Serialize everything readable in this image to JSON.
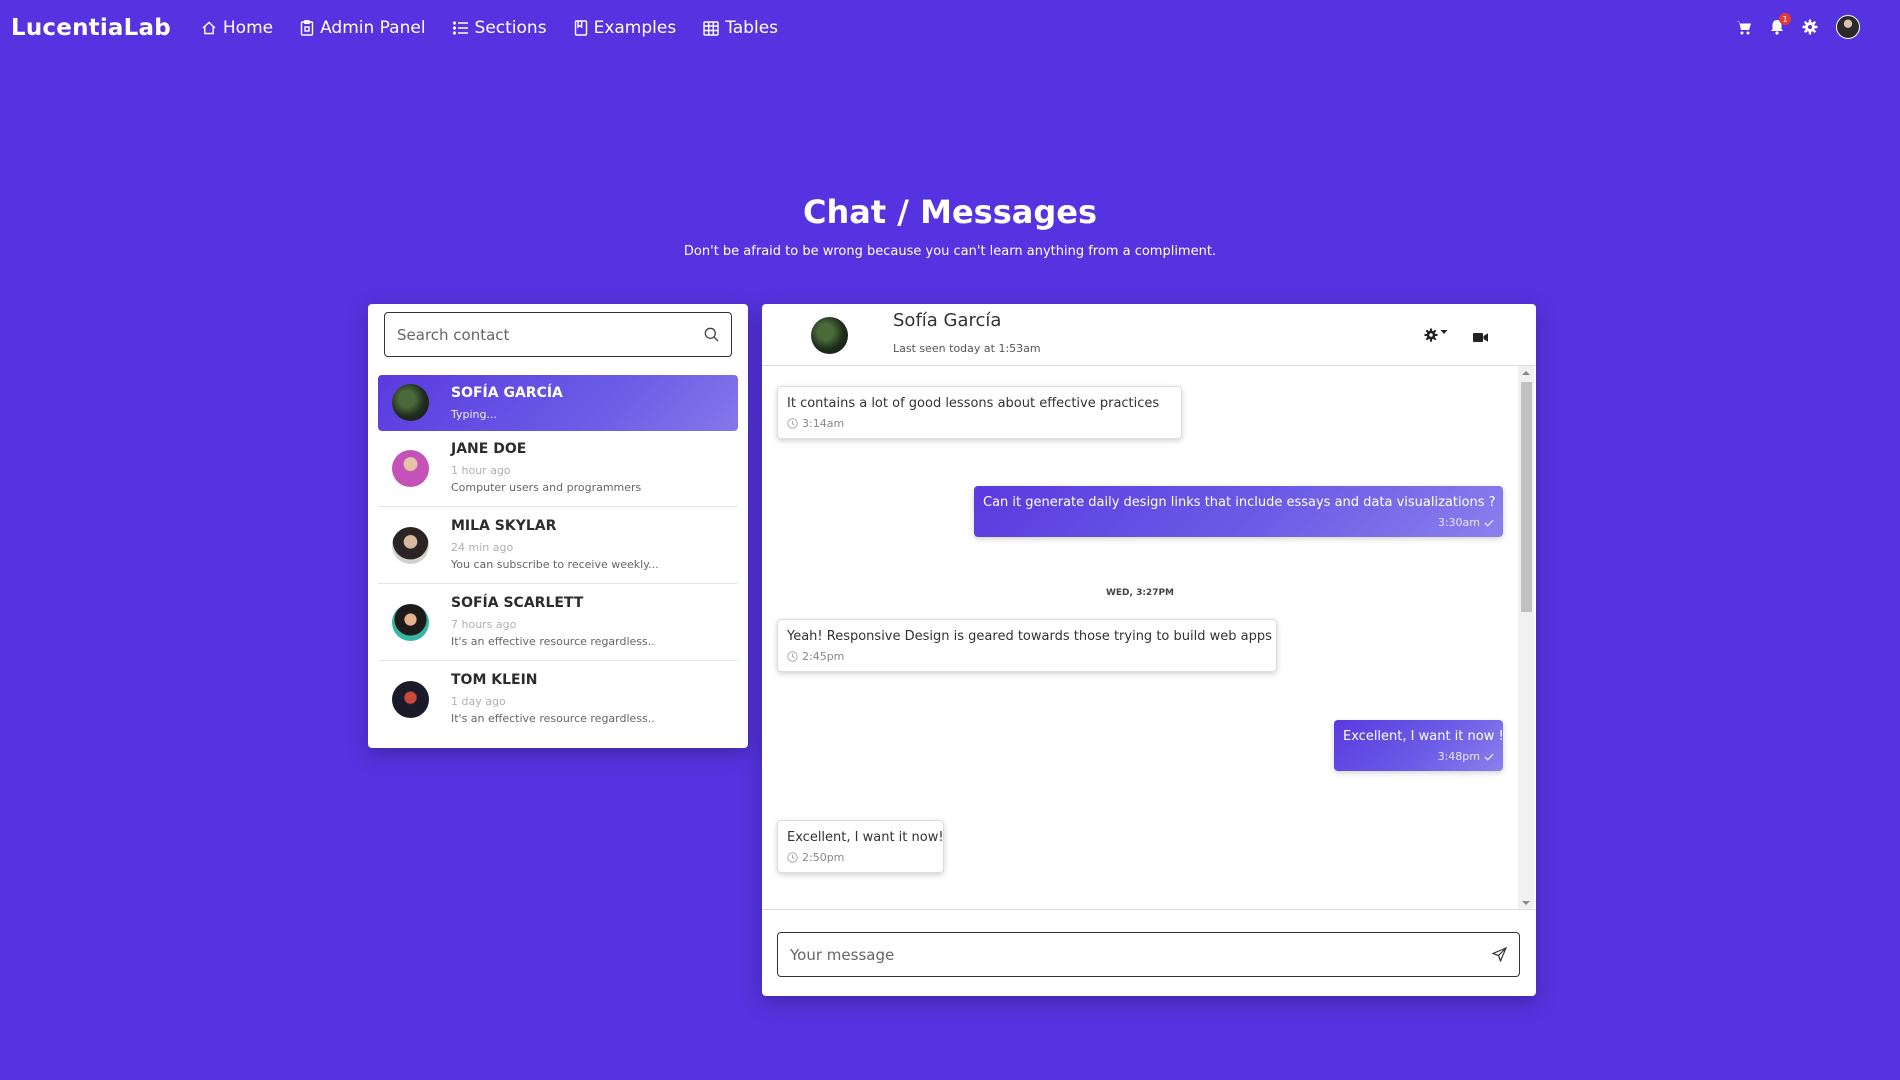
{
  "nav": {
    "brand": "LucentiaLab",
    "links": [
      {
        "label": "Home",
        "icon": "home-icon"
      },
      {
        "label": "Admin Panel",
        "icon": "clipboard-icon"
      },
      {
        "label": "Sections",
        "icon": "list-icon"
      },
      {
        "label": "Examples",
        "icon": "bookmark-icon"
      },
      {
        "label": "Tables",
        "icon": "table-icon"
      }
    ],
    "notification_count": "1"
  },
  "header": {
    "title": "Chat / Messages",
    "subtitle": "Don't be afraid to be wrong because you can't learn anything from a compliment."
  },
  "contacts": {
    "search_placeholder": "Search contact",
    "items": [
      {
        "name": "Sofía García",
        "status": "Typing...",
        "preview": "",
        "active": true
      },
      {
        "name": "Jane Doe",
        "status": "1 hour ago",
        "preview": "Computer users and programmers"
      },
      {
        "name": "Mila Skylar",
        "status": "24 min ago",
        "preview": "You can subscribe to receive weekly..."
      },
      {
        "name": "Sofía Scarlett",
        "status": "7 hours ago",
        "preview": "It's an effective resource regardless.."
      },
      {
        "name": "Tom Klein",
        "status": "1 day ago",
        "preview": "It's an effective resource regardless.."
      }
    ]
  },
  "chat": {
    "contact_name": "Sofía García",
    "last_seen": "Last seen today at 1:53am",
    "day_divider": "WED, 3:27PM",
    "messages": [
      {
        "direction": "in",
        "text": "It contains a lot of good lessons about effective practices",
        "time": "3:14am"
      },
      {
        "direction": "out",
        "text": "Can it generate daily design links that include essays and data visualizations ?",
        "time": "3:30am"
      },
      {
        "direction": "in",
        "text": "Yeah! Responsive Design is geared towards those trying to build web apps",
        "time": "2:45pm"
      },
      {
        "direction": "out",
        "text": "Excellent, I want it now !",
        "time": "3:48pm"
      },
      {
        "direction": "in",
        "text": "Excellent, I want it now!",
        "time": "2:50pm"
      }
    ],
    "message_placeholder": "Your message"
  },
  "colors": {
    "background": "#5533e0",
    "accent_gradient_start": "#5b3ae0",
    "accent_gradient_end": "#8677ea"
  }
}
